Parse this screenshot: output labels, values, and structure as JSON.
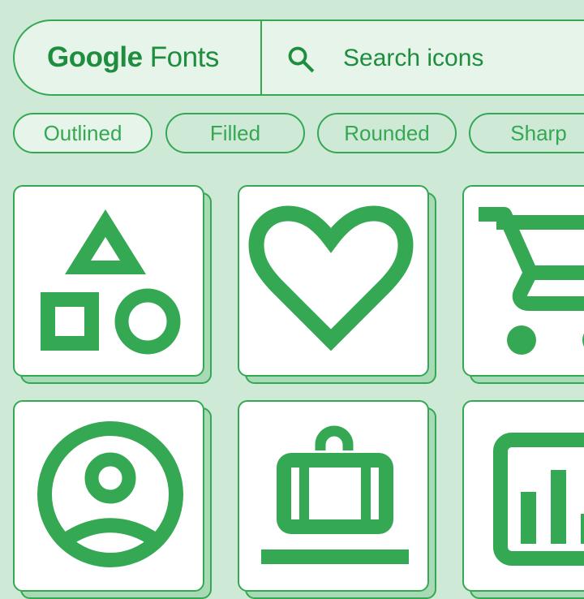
{
  "header": {
    "brand_primary": "Google",
    "brand_secondary": "Fonts",
    "search_icon": "search-icon",
    "search_placeholder": "Search icons"
  },
  "style_chips": [
    {
      "label": "Outlined",
      "selected": true
    },
    {
      "label": "Filled",
      "selected": false
    },
    {
      "label": "Rounded",
      "selected": false
    },
    {
      "label": "Sharp",
      "selected": false
    }
  ],
  "icon_grid": [
    {
      "icon": "category-icon"
    },
    {
      "icon": "favorite-icon"
    },
    {
      "icon": "shopping-cart-icon"
    },
    {
      "icon": "account-circle-icon"
    },
    {
      "icon": "luggage-icon"
    },
    {
      "icon": "analytics-icon"
    }
  ],
  "colors": {
    "background": "#cfe9d7",
    "accent": "#34a853",
    "text_accent": "#1e8e3e",
    "surface": "#e6f4ea",
    "card": "#ffffff",
    "card_shadow": "#a8dab5"
  }
}
